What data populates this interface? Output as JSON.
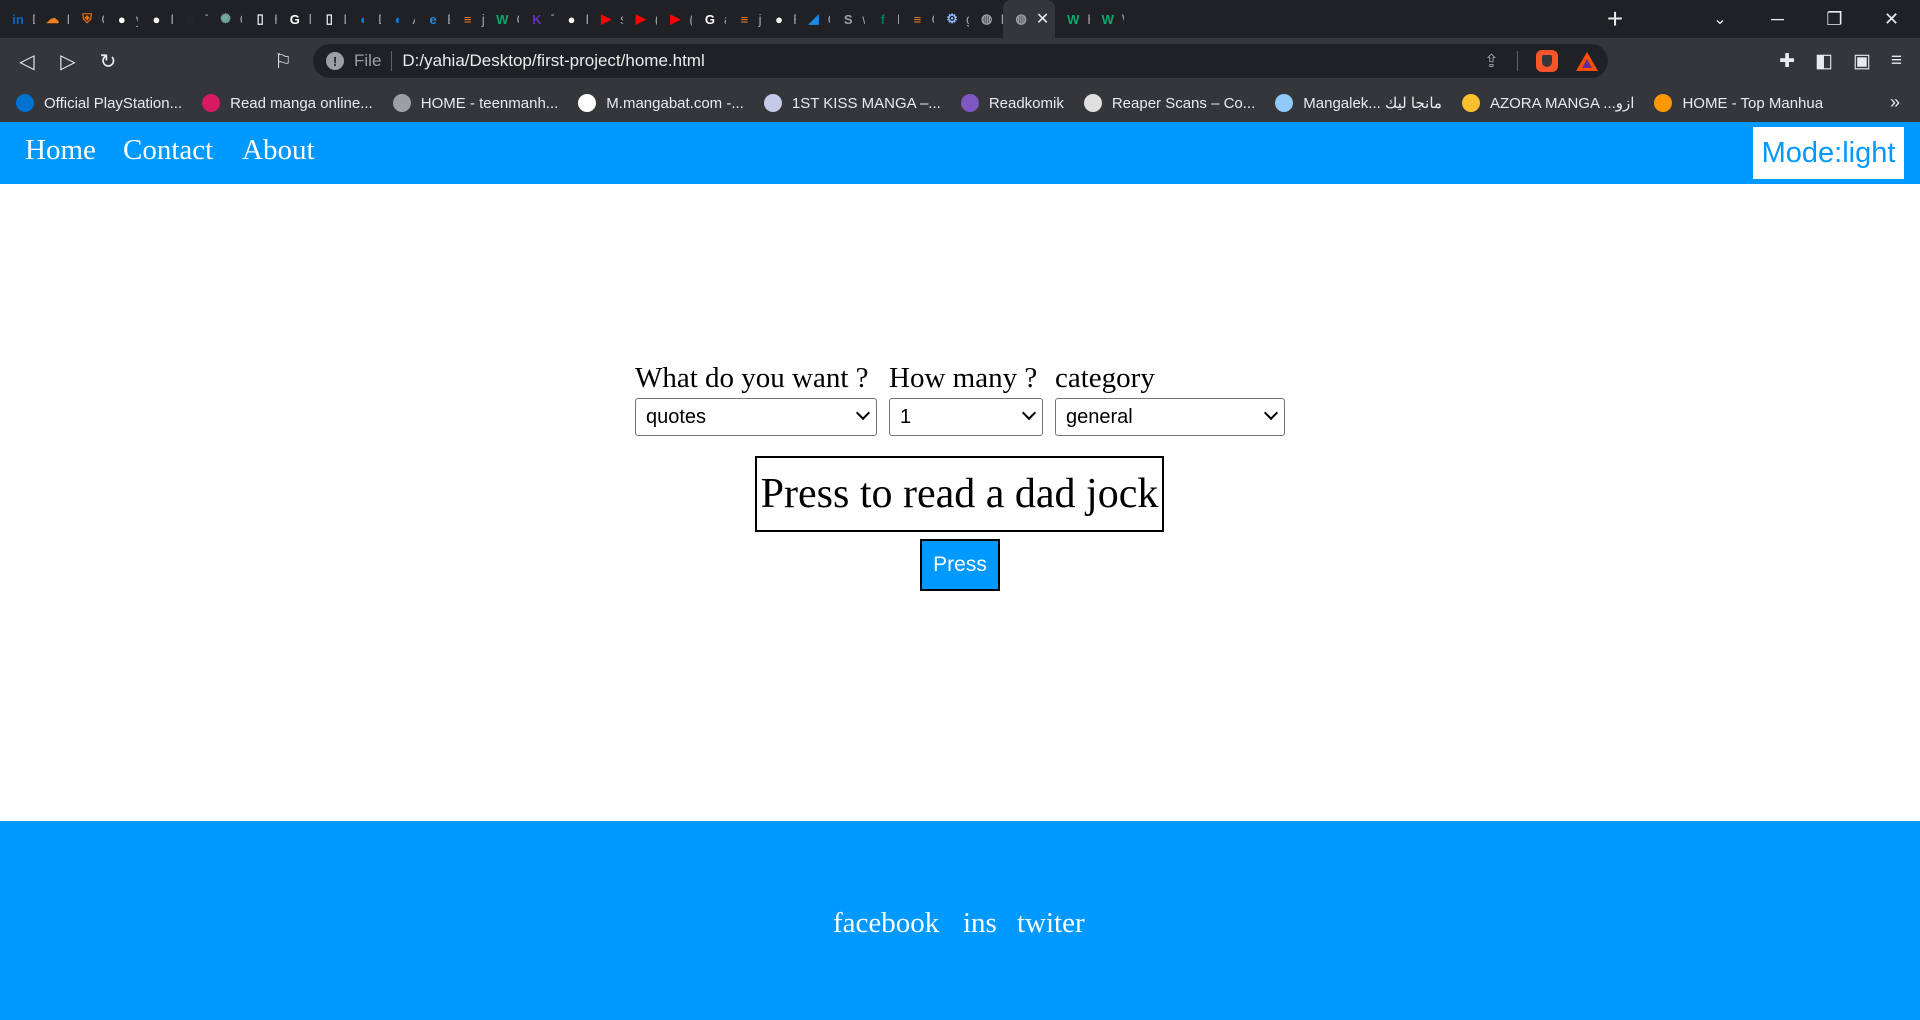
{
  "browser": {
    "tabs": [
      {
        "icon": "linkedin-icon",
        "title": "D",
        "color": "#0a66c2",
        "glyph": "in"
      },
      {
        "icon": "cloud-icon",
        "title": "H",
        "color": "#f38020",
        "glyph": "☁"
      },
      {
        "icon": "shield-icon",
        "title": "C",
        "color": "#e8710a",
        "glyph": "⛨"
      },
      {
        "icon": "github-icon",
        "title": "y",
        "color": "#ffffff",
        "glyph": "●"
      },
      {
        "icon": "github-icon",
        "title": "P",
        "color": "#ffffff",
        "glyph": "●"
      },
      {
        "icon": "steam-icon",
        "title": "T",
        "color": "#1b2838",
        "glyph": "S"
      },
      {
        "icon": "chatgpt-icon",
        "title": "C",
        "color": "#74aa9c",
        "glyph": "✺"
      },
      {
        "icon": "document-icon",
        "title": "H",
        "color": "#e8eaed",
        "glyph": "▯"
      },
      {
        "icon": "google-icon",
        "title": "li",
        "color": "#ffffff",
        "glyph": "G"
      },
      {
        "icon": "document-icon",
        "title": "Li",
        "color": "#e8eaed",
        "glyph": "▯"
      },
      {
        "icon": "digitalocean-icon",
        "title": "D",
        "color": "#0080ff",
        "glyph": "◐"
      },
      {
        "icon": "digitalocean-icon",
        "title": "A",
        "color": "#0080ff",
        "glyph": "◐"
      },
      {
        "icon": "edge-icon",
        "title": "Er",
        "color": "#1e88e5",
        "glyph": "e"
      },
      {
        "icon": "stackoverflow-icon",
        "title": "ja",
        "color": "#f48024",
        "glyph": "≡"
      },
      {
        "icon": "w-icon",
        "title": "C",
        "color": "#04aa6d",
        "glyph": "W"
      },
      {
        "icon": "k-icon",
        "title": "Tl",
        "color": "#5e35b1",
        "glyph": "K"
      },
      {
        "icon": "github-icon",
        "title": "L",
        "color": "#ffffff",
        "glyph": "●"
      },
      {
        "icon": "youtube-icon",
        "title": "sl",
        "color": "#ff0000",
        "glyph": "▶"
      },
      {
        "icon": "youtube-icon",
        "title": "(",
        "color": "#ff0000",
        "glyph": "▶"
      },
      {
        "icon": "youtube-icon",
        "title": "(",
        "color": "#ff0000",
        "glyph": "▶"
      },
      {
        "icon": "google-icon",
        "title": "a",
        "color": "#ffffff",
        "glyph": "G"
      },
      {
        "icon": "stackoverflow-icon",
        "title": "ja",
        "color": "#f48024",
        "glyph": "≡"
      },
      {
        "icon": "medium-icon",
        "title": "R",
        "color": "#ffffff",
        "glyph": "●"
      },
      {
        "icon": "wing-icon",
        "title": "C",
        "color": "#1e88e5",
        "glyph": "◢"
      },
      {
        "icon": "s-icon",
        "title": "w",
        "color": "#9aa0a6",
        "glyph": "S"
      },
      {
        "icon": "f-icon",
        "title": "H",
        "color": "#00796b",
        "glyph": "f"
      },
      {
        "icon": "stackoverflow-icon",
        "title": "C",
        "color": "#f48024",
        "glyph": "≡"
      },
      {
        "icon": "gear-icon",
        "title": "g",
        "color": "#8ab4f8",
        "glyph": "⚙"
      },
      {
        "icon": "globe-icon",
        "title": "H",
        "color": "#9aa0a6",
        "glyph": "◍"
      },
      {
        "icon": "globe-icon",
        "title": "",
        "color": "#9aa0a6",
        "glyph": "◍",
        "active": true
      },
      {
        "icon": "w-icon",
        "title": "H",
        "color": "#04aa6d",
        "glyph": "W"
      },
      {
        "icon": "w-icon",
        "title": "W",
        "color": "#04aa6d",
        "glyph": "W"
      }
    ],
    "address": {
      "scheme_label": "File",
      "url": "D:/yahia/Desktop/first-project/home.html"
    },
    "bookmarks": [
      {
        "label": "Official PlayStation...",
        "icon": "playstation-icon",
        "color": "#0070d1"
      },
      {
        "label": "Read manga online...",
        "icon": "manga-icon",
        "color": "#d81b60"
      },
      {
        "label": "HOME - teenmanh...",
        "icon": "globe-icon",
        "color": "#9aa0a6"
      },
      {
        "label": "M.mangabat.com -...",
        "icon": "mangabat-icon",
        "color": "#ffffff"
      },
      {
        "label": "1ST KISS MANGA –...",
        "icon": "kiss-manga-icon",
        "color": "#c5cae9"
      },
      {
        "label": "Readkomik",
        "icon": "readkomik-icon",
        "color": "#7e57c2"
      },
      {
        "label": "Reaper Scans – Co...",
        "icon": "reaper-icon",
        "color": "#e0e0e0"
      },
      {
        "label": "Mangalek... مانجا ليك",
        "icon": "mangalek-icon",
        "color": "#90caf9"
      },
      {
        "label": "AZORA MANGA ...ازو",
        "icon": "azora-icon",
        "color": "#fbc02d"
      },
      {
        "label": "HOME - Top Manhua",
        "icon": "topmanhua-icon",
        "color": "#ff9800"
      }
    ]
  },
  "site": {
    "nav": {
      "home": "Home",
      "contact": "Contact",
      "about": "About",
      "mode": "Mode:light"
    },
    "form": {
      "want_label": "What do you want ?",
      "want_value": "quotes",
      "count_label": "How many ?",
      "count_value": "1",
      "category_label": "category",
      "category_value": "general"
    },
    "display_text": "Press to read a dad jock",
    "press_label": "Press",
    "footer": {
      "facebook": "facebook",
      "ins": "ins",
      "twitter": "twiter"
    },
    "colors": {
      "accent": "#0099ff",
      "text_on_accent": "#ffffff"
    }
  }
}
